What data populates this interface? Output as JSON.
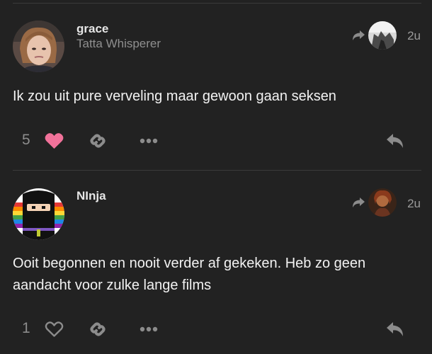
{
  "posts": [
    {
      "username": "grace",
      "user_title": "Tatta Whisperer",
      "date": "2u",
      "body": "Ik zou uit pure verveling maar gewoon gaan seksen",
      "like_count": "5",
      "liked": true,
      "avatar_icon": "user-photo",
      "reply_to_icon": "user-photo"
    },
    {
      "username": "NInja",
      "user_title": "",
      "date": "2u",
      "body": "Ooit begonnen en nooit verder af gekeken. Heb zo geen aandacht voor zulke lange films",
      "like_count": "1",
      "liked": false,
      "avatar_icon": "ninja-avatar",
      "reply_to_icon": "user-photo"
    }
  ],
  "colors": {
    "background": "#222222",
    "heart_liked": "#f1729a",
    "icon": "#8c8c8c",
    "divider": "#3b3b3b"
  }
}
